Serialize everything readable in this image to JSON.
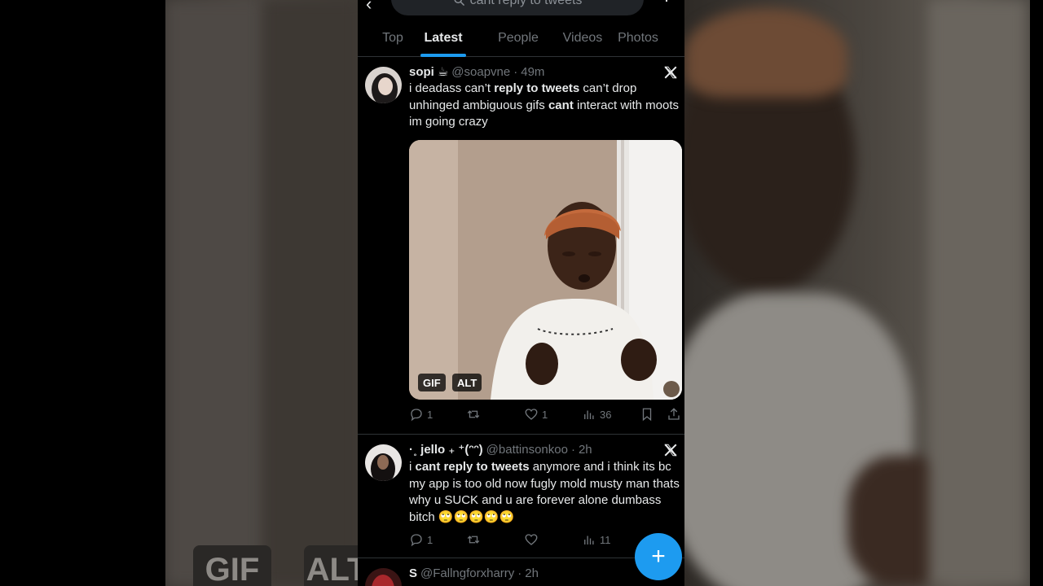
{
  "search": {
    "query": "cant reply to tweets"
  },
  "tabs": [
    {
      "label": "Top",
      "active": false
    },
    {
      "label": "Latest",
      "active": true
    },
    {
      "label": "People",
      "active": false
    },
    {
      "label": "Videos",
      "active": false
    },
    {
      "label": "Photos",
      "active": false
    }
  ],
  "tweets": [
    {
      "name": "sopi",
      "name_emoji": "☕",
      "handle": "@soapvne",
      "time": "49m",
      "text_parts": [
        {
          "t": "i deadass can’t ",
          "b": false
        },
        {
          "t": "reply to tweets",
          "b": true
        },
        {
          "t": " can’t drop unhinged ambiguous gifs ",
          "b": false
        },
        {
          "t": "cant",
          "b": true
        },
        {
          "t": " interact with moots im going crazy",
          "b": false
        }
      ],
      "media_badges": [
        "GIF",
        "ALT"
      ],
      "replies": "1",
      "retweets": "",
      "likes": "1",
      "views": "36"
    },
    {
      "name": "·˳ jello ₊ ⁺(ᵔᵔ)",
      "handle": "@battinsonkoo",
      "time": "2h",
      "text_parts": [
        {
          "t": "i ",
          "b": false
        },
        {
          "t": "cant reply to tweets",
          "b": true
        },
        {
          "t": " anymore and i think its bc my app is too old now fugly mold musty man thats why u SUCK and u are forever alone dumbass bitch 🙄🙄🙄🙄🙄",
          "b": false
        }
      ],
      "replies": "1",
      "retweets": "",
      "likes": "",
      "views": "11"
    },
    {
      "name": "S",
      "handle": "@Fallngforxharry",
      "time": "2h"
    }
  ],
  "backdrop_badges": [
    "GIF",
    "ALT"
  ],
  "colors": {
    "accent": "#1d9bf0",
    "background": "#000000",
    "text": "#e7e9ea",
    "muted": "#71767b"
  }
}
